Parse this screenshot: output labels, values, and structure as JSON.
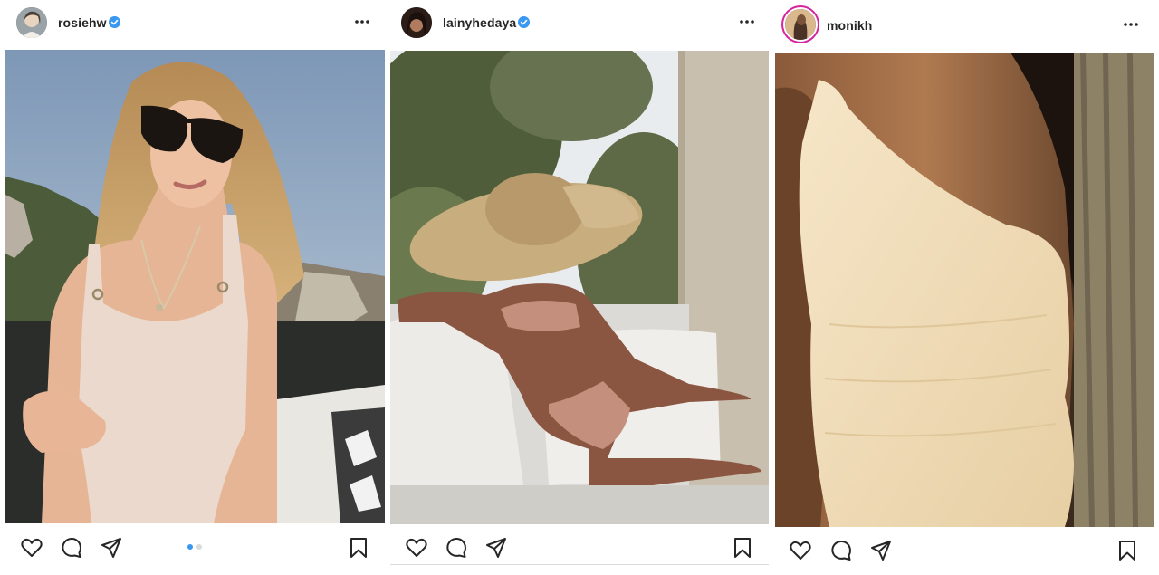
{
  "posts": [
    {
      "username": "rosiehw",
      "verified": true,
      "more_icon": "more-horizontal-icon",
      "photo_subject": "blonde woman in sunglasses and knit one-piece swimsuit seated by the sea cliffs",
      "carousel": {
        "count": 2,
        "active": 1
      },
      "icons": [
        "heart-icon",
        "comment-icon",
        "share-icon",
        "bookmark-icon"
      ]
    },
    {
      "username": "lainyhedaya",
      "verified": true,
      "more_icon": "more-horizontal-icon",
      "photo_subject": "woman in oversized straw hat and pink bikini lounging on white sofa under olive trees",
      "icons": [
        "heart-icon",
        "comment-icon",
        "share-icon",
        "bookmark-icon"
      ]
    },
    {
      "username": "monikh",
      "verified": false,
      "story_ring": true,
      "more_icon": "more-horizontal-icon",
      "photo_subject": "close-up of one-shoulder textured cream swimsuit in warm light",
      "icons": [
        "heart-icon",
        "comment-icon",
        "share-icon",
        "bookmark-icon"
      ]
    }
  ],
  "colors": {
    "verified_blue": "#3897f0",
    "text": "#262626",
    "divider": "#dbdbdb",
    "story_ring": "#d6249f"
  }
}
